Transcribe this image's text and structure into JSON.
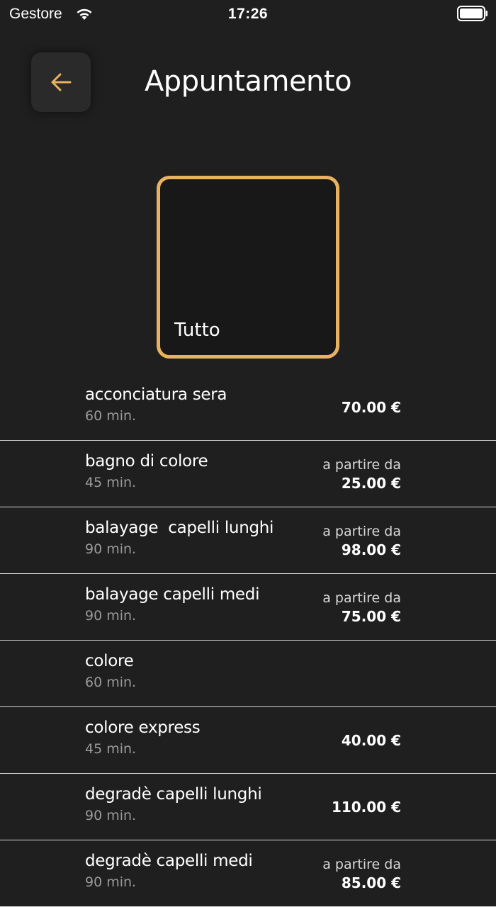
{
  "status_bar": {
    "carrier": "Gestore",
    "time": "17:26"
  },
  "header": {
    "title": "Appuntamento",
    "back_icon": "arrow-left-icon",
    "accent_color": "#e9b260"
  },
  "category": {
    "label": "Tutto",
    "selected": true
  },
  "services": [
    {
      "name": "acconciatura sera",
      "duration": "60 min.",
      "prefix": "",
      "price": "70.00 €"
    },
    {
      "name": "bagno di colore",
      "duration": "45 min.",
      "prefix": "a partire da",
      "price": "25.00 €"
    },
    {
      "name": "balayage  capelli lunghi",
      "duration": "90 min.",
      "prefix": "a partire da",
      "price": "98.00 €"
    },
    {
      "name": "balayage capelli medi",
      "duration": "90 min.",
      "prefix": "a partire da",
      "price": "75.00 €"
    },
    {
      "name": "colore",
      "duration": "60 min.",
      "prefix": "",
      "price": ""
    },
    {
      "name": "colore express",
      "duration": "45 min.",
      "prefix": "",
      "price": "40.00 €"
    },
    {
      "name": "degradè capelli lunghi",
      "duration": "90 min.",
      "prefix": "",
      "price": "110.00 €"
    },
    {
      "name": "degradè capelli medi",
      "duration": "90 min.",
      "prefix": "a partire da",
      "price": "85.00 €"
    }
  ]
}
